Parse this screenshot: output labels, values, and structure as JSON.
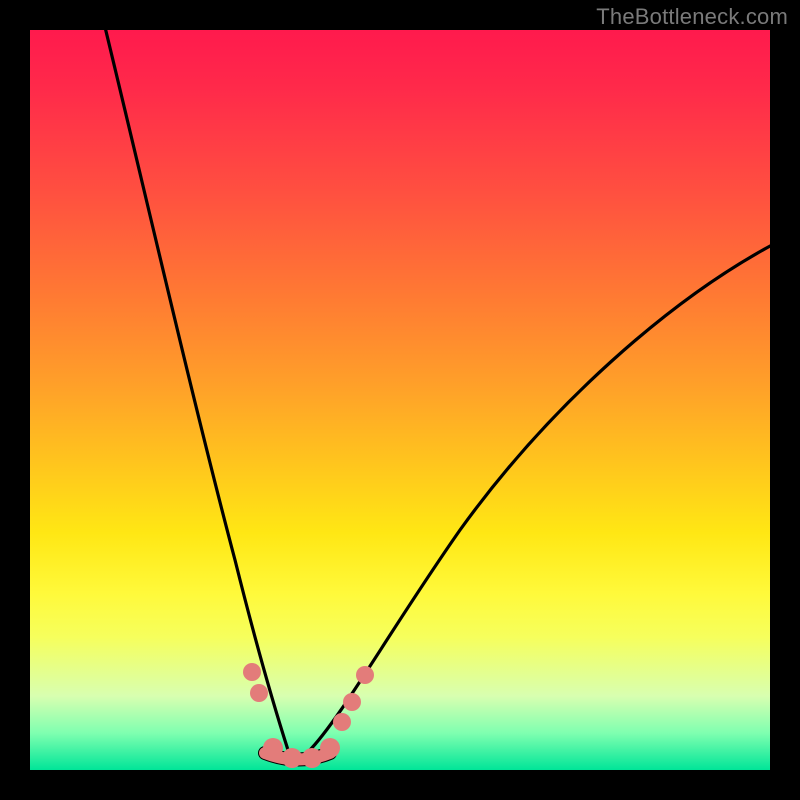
{
  "watermark": {
    "text": "TheBottleneck.com"
  },
  "colors": {
    "bg_top": "#ff1a4d",
    "bg_bottom": "#00e598",
    "curve": "#000000",
    "beads": "#e37c7a",
    "frame": "#000000"
  },
  "chart_data": {
    "type": "line",
    "title": "",
    "xlabel": "",
    "ylabel": "",
    "xlim": [
      0,
      100
    ],
    "ylim": [
      0,
      100
    ],
    "grid": false,
    "legend": false,
    "series": [
      {
        "name": "bottleneck-curve-left",
        "x": [
          10,
          13,
          16,
          19,
          22,
          25,
          27,
          29,
          31,
          33,
          34,
          35,
          36
        ],
        "y": [
          100,
          84,
          68,
          53,
          40,
          28,
          20,
          14,
          9,
          5,
          3,
          2,
          1
        ]
      },
      {
        "name": "bottleneck-curve-right",
        "x": [
          36,
          38,
          40,
          42,
          45,
          50,
          56,
          63,
          70,
          78,
          86,
          94,
          100
        ],
        "y": [
          1,
          2,
          3,
          5,
          9,
          15,
          23,
          32,
          41,
          49,
          57,
          64,
          69
        ]
      },
      {
        "name": "bottleneck-floor",
        "x": [
          33,
          40
        ],
        "y": [
          1,
          1
        ]
      }
    ],
    "markers": [
      {
        "name": "bead-left-upper",
        "x": 30.5,
        "y": 12
      },
      {
        "name": "bead-left-lower",
        "x": 31.5,
        "y": 9
      },
      {
        "name": "bead-floor-1",
        "x": 33.0,
        "y": 2.0
      },
      {
        "name": "bead-floor-2",
        "x": 35.5,
        "y": 1.5
      },
      {
        "name": "bead-floor-3",
        "x": 38.0,
        "y": 1.5
      },
      {
        "name": "bead-floor-4",
        "x": 40.5,
        "y": 2.0
      },
      {
        "name": "bead-right-lower",
        "x": 42.5,
        "y": 6
      },
      {
        "name": "bead-right-mid",
        "x": 43.8,
        "y": 9
      },
      {
        "name": "bead-right-upper",
        "x": 45.5,
        "y": 13
      }
    ]
  }
}
